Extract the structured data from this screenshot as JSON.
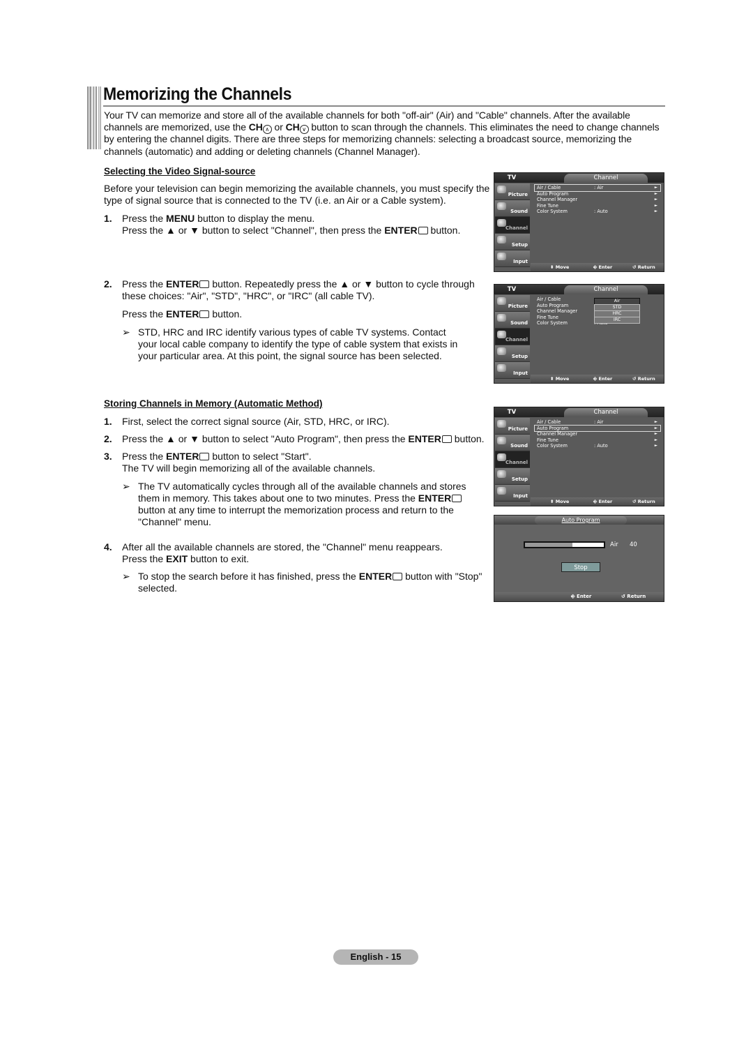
{
  "title": "Memorizing the Channels",
  "intro": {
    "p1": "Your TV can memorize and store all of the available channels for both \"off-air\" (Air) and \"Cable\" channels. After the available channels are memorized, use the ",
    "ch": "CH",
    "or": " or ",
    "p2": " button to scan through the channels. This eliminates the need to change channels by entering the channel digits. There are three steps for memorizing channels: selecting a broadcast source, memorizing the channels (automatic) and adding or deleting channels (Channel Manager)."
  },
  "section1": {
    "heading": "Selecting the Video Signal-source",
    "para": "Before your television can begin memorizing the available channels, you must specify the type of signal source that is connected to the TV (i.e. an Air or a Cable system).",
    "step1": {
      "num": "1.",
      "a": "Press the ",
      "menu": "MENU",
      "b": " button to display the menu.",
      "c": "Press the ▲ or ▼ button to select \"Channel\", then press the ",
      "enter": "ENTER",
      "d": " button."
    },
    "step2": {
      "num": "2.",
      "a": "Press the ",
      "enter": "ENTER",
      "b": " button. Repeatedly press the ▲ or ▼ button to cycle through these choices: \"Air\", \"STD\", \"HRC\", or \"IRC\" (all cable TV).",
      "c": "Press the ",
      "d": " button."
    },
    "note": {
      "arrow": "➢",
      "text": "STD, HRC and IRC identify various types of cable TV systems. Contact your local cable company to identify the type of cable system that exists in your particular area. At this point, the signal source has been selected."
    }
  },
  "section2": {
    "heading": "Storing Channels in Memory (Automatic Method)",
    "step1": {
      "num": "1.",
      "text": "First, select the correct signal source (Air, STD, HRC, or IRC)."
    },
    "step2": {
      "num": "2.",
      "a": "Press the ▲ or ▼ button to select \"Auto Program\", then press the ",
      "enter": "ENTER",
      "b": " button."
    },
    "step3": {
      "num": "3.",
      "a": "Press the ",
      "enter": "ENTER",
      "b": " button to select \"Start\".",
      "c": "The TV will begin memorizing  all of the available channels."
    },
    "note3": {
      "arrow": "➢",
      "a": "The TV automatically cycles through all of the available channels and stores them in memory. This takes about one to two minutes. Press the ",
      "enter": "ENTER",
      "b": " button at any time to interrupt the memorization process and return to the \"Channel\" menu."
    },
    "step4": {
      "num": "4.",
      "a": "After all the available channels are stored, the \"Channel\" menu reappears.",
      "b": "Press the ",
      "exit": "EXIT",
      "c": " button to exit."
    },
    "note4": {
      "arrow": "➢",
      "a": "To stop the search before it has finished, press the ",
      "enter": "ENTER",
      "b": " button with \"Stop\" selected."
    }
  },
  "osd": {
    "tv_label": "TV",
    "menu_title": "Channel",
    "sidebar": [
      "Picture",
      "Sound",
      "Channel",
      "Setup",
      "Input"
    ],
    "items": [
      {
        "label": "Air / Cable",
        "value": ": Air"
      },
      {
        "label": "Auto Program",
        "value": ""
      },
      {
        "label": "Channel Manager",
        "value": ""
      },
      {
        "label": "Fine Tune",
        "value": ""
      },
      {
        "label": "Color System",
        "value": ": Auto"
      }
    ],
    "arrow": "►",
    "footer": {
      "move": "⬍ Move",
      "enter": "⎆ Enter",
      "return": "↺ Return"
    },
    "dropdown": {
      "colon": ":",
      "options": [
        "Air",
        "STD",
        "HRC",
        "IRC"
      ],
      "selected": "Air"
    }
  },
  "auto_program": {
    "title": "Auto Program",
    "progress_percent": 60,
    "source": "Air",
    "channel": "40",
    "stop_label": "Stop",
    "footer": {
      "enter": "⎆ Enter",
      "return": "↺ Return"
    }
  },
  "page_label": "English - 15"
}
